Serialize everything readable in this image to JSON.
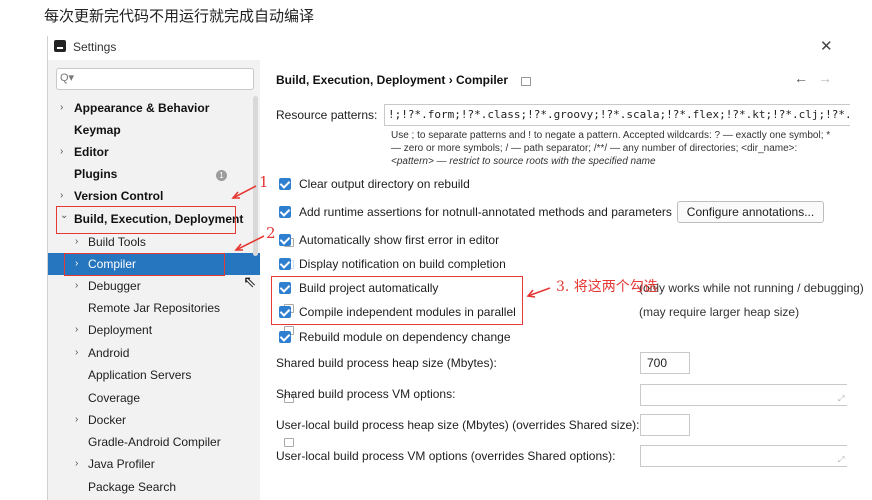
{
  "caption": "每次更新完代码不用运行就完成自动编译",
  "window": {
    "title": "Settings",
    "close_icon": "✕"
  },
  "sidebar": {
    "search_placeholder": "Q▾",
    "items": [
      {
        "label": "Appearance & Behavior",
        "arrow": "›",
        "bold": true
      },
      {
        "label": "Keymap",
        "arrow": "",
        "bold": true
      },
      {
        "label": "Editor",
        "arrow": "›",
        "bold": true
      },
      {
        "label": "Plugins",
        "arrow": "",
        "bold": true,
        "badge": "1"
      },
      {
        "label": "Version Control",
        "arrow": "›",
        "bold": true
      },
      {
        "label": "Build, Execution, Deployment",
        "arrow": "⌄",
        "bold": true
      },
      {
        "label": "Build Tools",
        "arrow": "›"
      },
      {
        "label": "Compiler",
        "arrow": "›",
        "selected": true
      },
      {
        "label": "Debugger",
        "arrow": "›"
      },
      {
        "label": "Remote Jar Repositories",
        "arrow": ""
      },
      {
        "label": "Deployment",
        "arrow": "›"
      },
      {
        "label": "Android",
        "arrow": "›"
      },
      {
        "label": "Application Servers",
        "arrow": ""
      },
      {
        "label": "Coverage",
        "arrow": ""
      },
      {
        "label": "Docker",
        "arrow": "›"
      },
      {
        "label": "Gradle-Android Compiler",
        "arrow": ""
      },
      {
        "label": "Java Profiler",
        "arrow": "›"
      },
      {
        "label": "Package Search",
        "arrow": ""
      }
    ]
  },
  "main": {
    "breadcrumb": "Build, Execution, Deployment  ›  Compiler",
    "nav_back": "←",
    "nav_forward": "→",
    "resource_patterns": {
      "label": "Resource patterns:",
      "value": "!;!?*.form;!?*.class;!?*.groovy;!?*.scala;!?*.flex;!?*.kt;!?*.clj;!?*.aj",
      "help": [
        "Use ; to separate patterns and ! to negate a pattern. Accepted wildcards: ? — exactly one symbol; *",
        "— zero or more symbols; / — path separator; /**/ — any number of directories; <dir_name>:",
        "<pattern> — restrict to source roots with the specified name"
      ]
    },
    "checkboxes": [
      {
        "label": "Clear output directory on rebuild"
      },
      {
        "label": "Add runtime assertions for notnull-annotated methods and parameters"
      },
      {
        "label": "Automatically show first error in editor"
      },
      {
        "label": "Display notification on build completion"
      },
      {
        "label": "Build project automatically"
      },
      {
        "label": "Compile independent modules in parallel"
      },
      {
        "label": "Rebuild module on dependency change"
      }
    ],
    "configure_button": "Configure annotations...",
    "notes": {
      "build_auto": "(only works while not running / debugging)",
      "parallel": "(may require larger heap size)"
    },
    "fields": [
      {
        "label": "Shared build process heap size (Mbytes):",
        "value": "700"
      },
      {
        "label": "Shared build process VM options:",
        "value": ""
      },
      {
        "label": "User-local build process heap size (Mbytes) (overrides Shared size):",
        "value": ""
      },
      {
        "label": "User-local build process VM options (overrides Shared options):",
        "value": ""
      }
    ]
  },
  "annotations": {
    "one": "1",
    "two": "2",
    "three": "3. 将这两个勾选"
  },
  "colors": {
    "selection": "#2675bf",
    "checkbox": "#2f7fd1",
    "annotation": "#e53935"
  }
}
